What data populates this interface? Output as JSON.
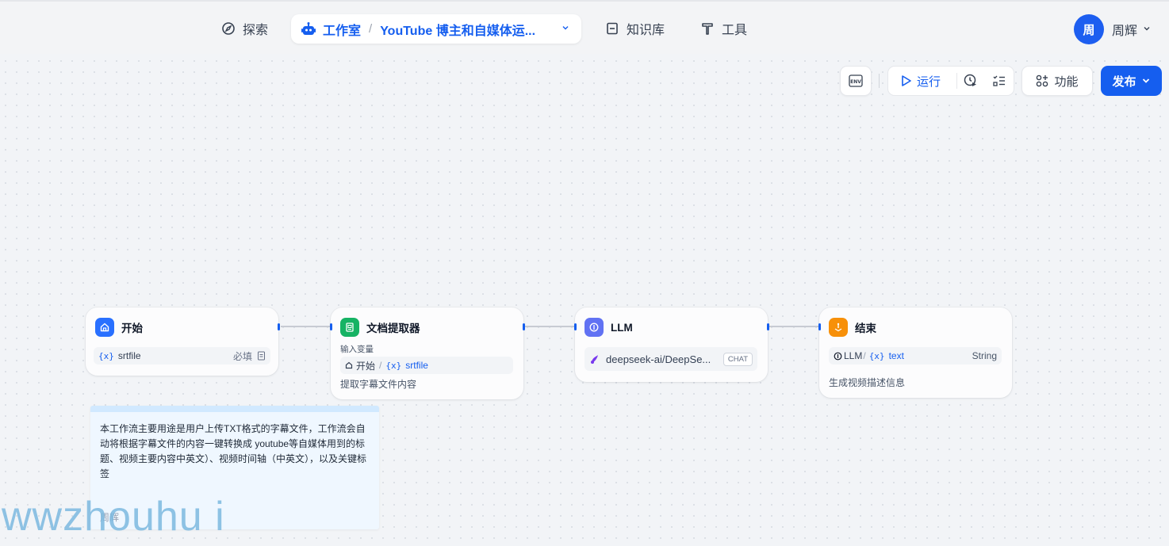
{
  "nav": {
    "explore": "探索",
    "studio": "工作室",
    "separator": "/",
    "app_name": "YouTube 博主和自媒体运...",
    "knowledge": "知识库",
    "tools": "工具"
  },
  "user": {
    "avatar_initial": "周",
    "name": "周辉"
  },
  "toolbar": {
    "env_label": "ENV",
    "run": "运行",
    "features": "功能",
    "publish": "发布"
  },
  "nodes": {
    "start": {
      "title": "开始",
      "var_icon": "{x}",
      "var_name": "srtfile",
      "required": "必填"
    },
    "doc_extractor": {
      "title": "文档提取器",
      "input_label": "输入变量",
      "input_source": "开始",
      "input_sep": "/",
      "var_icon": "{x}",
      "input_var": "srtfile",
      "description": "提取字幕文件内容"
    },
    "llm": {
      "title": "LLM",
      "model": "deepseek-ai/DeepSe...",
      "mode_badge": "CHAT"
    },
    "end": {
      "title": "结束",
      "source": "LLM",
      "sep": "/",
      "var_icon": "{x}",
      "var_name": "text",
      "type": "String",
      "description": "生成视频描述信息"
    }
  },
  "note": {
    "text": "本工作流主要用途是用户上传TXT格式的字幕文件，工作流会自动将根据字幕文件的内容一键转换成 youtube等自媒体用到的标题、视频主要内容中英文）、视频时间轴（中英文），以及关键标签",
    "author": "周辉"
  },
  "watermark": "wwzhouhu i",
  "colors": {
    "accent": "#155eef",
    "start_icon": "#2970ff",
    "doc_icon": "#16b364",
    "llm_icon": "#6172f3",
    "end_icon": "#f79009"
  }
}
